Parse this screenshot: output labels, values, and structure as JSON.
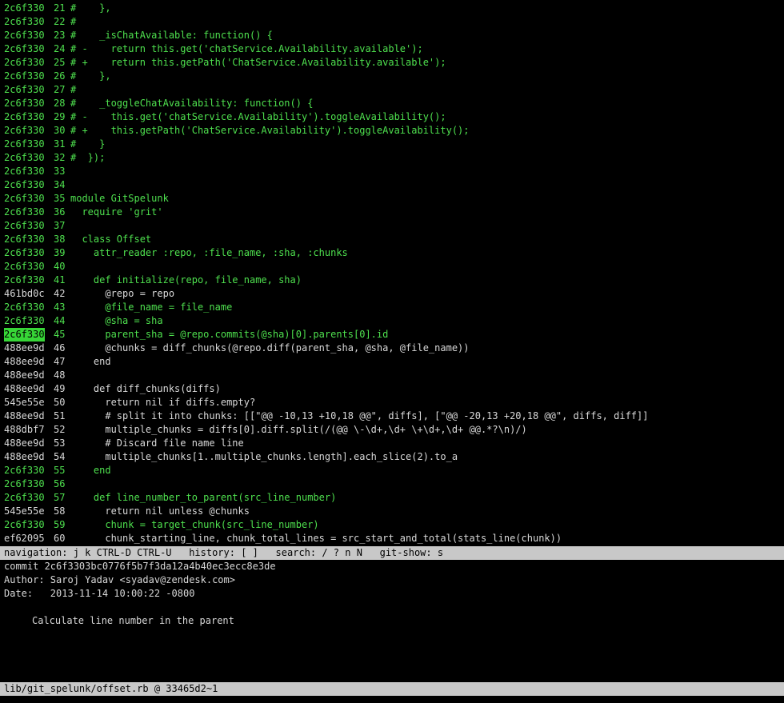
{
  "blame_lines": [
    {
      "sha": "2c6f330",
      "num": "21",
      "code": "#    },",
      "color": "green"
    },
    {
      "sha": "2c6f330",
      "num": "22",
      "code": "#",
      "color": "green"
    },
    {
      "sha": "2c6f330",
      "num": "23",
      "code": "#    _isChatAvailable: function() {",
      "color": "green"
    },
    {
      "sha": "2c6f330",
      "num": "24",
      "code": "# -    return this.get('chatService.Availability.available');",
      "color": "green"
    },
    {
      "sha": "2c6f330",
      "num": "25",
      "code": "# +    return this.getPath('ChatService.Availability.available');",
      "color": "green"
    },
    {
      "sha": "2c6f330",
      "num": "26",
      "code": "#    },",
      "color": "green"
    },
    {
      "sha": "2c6f330",
      "num": "27",
      "code": "#",
      "color": "green"
    },
    {
      "sha": "2c6f330",
      "num": "28",
      "code": "#    _toggleChatAvailability: function() {",
      "color": "green"
    },
    {
      "sha": "2c6f330",
      "num": "29",
      "code": "# -    this.get('chatService.Availability').toggleAvailability();",
      "color": "green"
    },
    {
      "sha": "2c6f330",
      "num": "30",
      "code": "# +    this.getPath('ChatService.Availability').toggleAvailability();",
      "color": "green"
    },
    {
      "sha": "2c6f330",
      "num": "31",
      "code": "#    }",
      "color": "green"
    },
    {
      "sha": "2c6f330",
      "num": "32",
      "code": "#  });",
      "color": "green"
    },
    {
      "sha": "2c6f330",
      "num": "33",
      "code": "",
      "color": "green"
    },
    {
      "sha": "2c6f330",
      "num": "34",
      "code": "",
      "color": "green"
    },
    {
      "sha": "2c6f330",
      "num": "35",
      "code": "module GitSpelunk",
      "color": "green"
    },
    {
      "sha": "2c6f330",
      "num": "36",
      "code": "  require 'grit'",
      "color": "green"
    },
    {
      "sha": "2c6f330",
      "num": "37",
      "code": "",
      "color": "green"
    },
    {
      "sha": "2c6f330",
      "num": "38",
      "code": "  class Offset",
      "color": "green"
    },
    {
      "sha": "2c6f330",
      "num": "39",
      "code": "    attr_reader :repo, :file_name, :sha, :chunks",
      "color": "green"
    },
    {
      "sha": "2c6f330",
      "num": "40",
      "code": "",
      "color": "green"
    },
    {
      "sha": "2c6f330",
      "num": "41",
      "code": "    def initialize(repo, file_name, sha)",
      "color": "green"
    },
    {
      "sha": "461bd0c",
      "num": "42",
      "code": "      @repo = repo",
      "color": "white"
    },
    {
      "sha": "2c6f330",
      "num": "43",
      "code": "      @file_name = file_name",
      "color": "green"
    },
    {
      "sha": "2c6f330",
      "num": "44",
      "code": "      @sha = sha",
      "color": "green"
    },
    {
      "sha": "2c6f330",
      "num": "45",
      "code": "      parent_sha = @repo.commits(@sha)[0].parents[0].id",
      "color": "green",
      "selected": true
    },
    {
      "sha": "488ee9d",
      "num": "46",
      "code": "      @chunks = diff_chunks(@repo.diff(parent_sha, @sha, @file_name))",
      "color": "white"
    },
    {
      "sha": "488ee9d",
      "num": "47",
      "code": "    end",
      "color": "white"
    },
    {
      "sha": "488ee9d",
      "num": "48",
      "code": "",
      "color": "white"
    },
    {
      "sha": "488ee9d",
      "num": "49",
      "code": "    def diff_chunks(diffs)",
      "color": "white"
    },
    {
      "sha": "545e55e",
      "num": "50",
      "code": "      return nil if diffs.empty?",
      "color": "white"
    },
    {
      "sha": "488ee9d",
      "num": "51",
      "code": "      # split it into chunks: [[\"@@ -10,13 +10,18 @@\", diffs], [\"@@ -20,13 +20,18 @@\", diffs, diff]]",
      "color": "white"
    },
    {
      "sha": "488dbf7",
      "num": "52",
      "code": "      multiple_chunks = diffs[0].diff.split(/(@@ \\-\\d+,\\d+ \\+\\d+,\\d+ @@.*?\\n)/)",
      "color": "white"
    },
    {
      "sha": "488ee9d",
      "num": "53",
      "code": "      # Discard file name line",
      "color": "white"
    },
    {
      "sha": "488ee9d",
      "num": "54",
      "code": "      multiple_chunks[1..multiple_chunks.length].each_slice(2).to_a",
      "color": "white"
    },
    {
      "sha": "2c6f330",
      "num": "55",
      "code": "    end",
      "color": "green"
    },
    {
      "sha": "2c6f330",
      "num": "56",
      "code": "",
      "color": "green"
    },
    {
      "sha": "2c6f330",
      "num": "57",
      "code": "    def line_number_to_parent(src_line_number)",
      "color": "green"
    },
    {
      "sha": "545e55e",
      "num": "58",
      "code": "      return nil unless @chunks",
      "color": "white"
    },
    {
      "sha": "2c6f330",
      "num": "59",
      "code": "      chunk = target_chunk(src_line_number)",
      "color": "green"
    },
    {
      "sha": "ef62095",
      "num": "60",
      "code": "      chunk_starting_line, chunk_total_lines = src_start_and_total(stats_line(chunk))",
      "color": "white"
    }
  ],
  "status_bar": {
    "text": "navigation: j k CTRL-D CTRL-U   history: [ ]   search: / ? n N   git-show: s"
  },
  "commit": {
    "header": "commit 2c6f3303bc0776f5b7f3da12a4b40ec3ecc8e3de",
    "author": "Author: Saroj Yadav <syadav@zendesk.com>",
    "date": "Date:   2013-11-14 10:00:22 -0800",
    "message": "Calculate line number in the parent"
  },
  "file_bar": {
    "text": "lib/git_spelunk/offset.rb @ 33465d2~1"
  },
  "colors": {
    "background": "#000000",
    "green": "#4ee04e",
    "white": "#d8d8d8",
    "bar": "#c8c8c8",
    "selected": "#37d637"
  }
}
